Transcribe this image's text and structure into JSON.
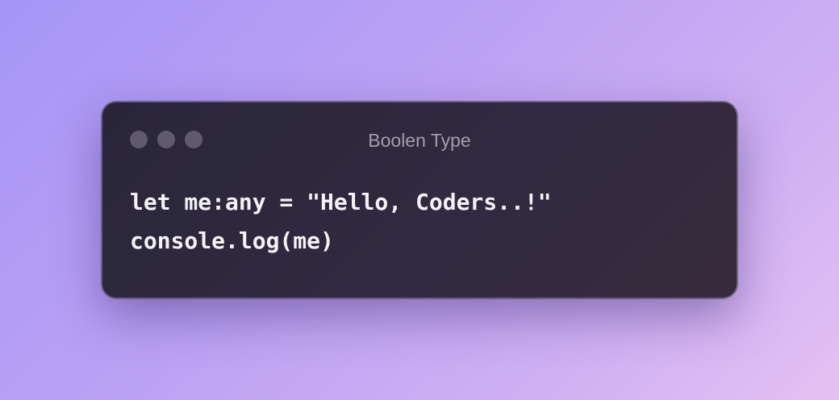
{
  "window": {
    "title": "Boolen Type",
    "traffic_lights": [
      "close",
      "minimize",
      "zoom"
    ]
  },
  "code": {
    "lines": [
      "let me:any = \"Hello, Coders..!\"",
      "console.log(me)"
    ]
  },
  "colors": {
    "window_bg": "#2a2638",
    "dot": "#5f5a6c",
    "title_text": "#a39cae",
    "code_text": "#f4f2f6"
  }
}
